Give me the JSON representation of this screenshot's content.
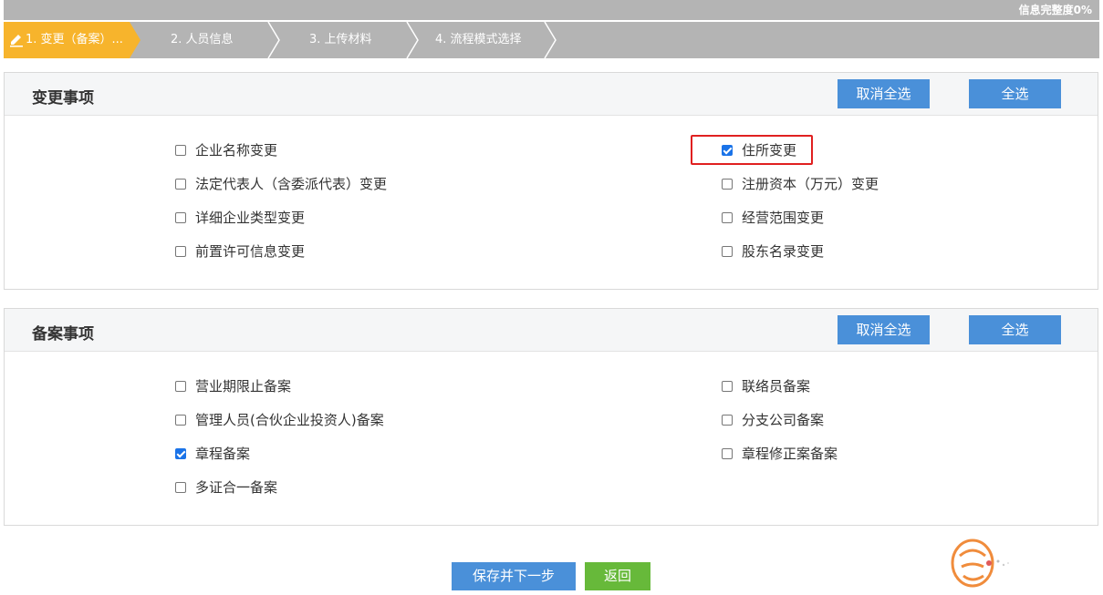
{
  "completion": {
    "text": "信息完整度0%"
  },
  "steps": [
    {
      "label": "1. 变更（备案）...",
      "active": true
    },
    {
      "label": "2. 人员信息",
      "active": false
    },
    {
      "label": "3. 上传材料",
      "active": false
    },
    {
      "label": "4. 流程模式选择",
      "active": false
    }
  ],
  "change_section": {
    "title": "变更事项",
    "cancel_all": "取消全选",
    "select_all": "全选",
    "left_options": [
      {
        "label": "企业名称变更",
        "checked": false
      },
      {
        "label": "法定代表人（含委派代表）变更",
        "checked": false
      },
      {
        "label": "详细企业类型变更",
        "checked": false
      },
      {
        "label": "前置许可信息变更",
        "checked": false
      }
    ],
    "right_options": [
      {
        "label": "住所变更",
        "checked": true
      },
      {
        "label": "注册资本（万元）变更",
        "checked": false
      },
      {
        "label": "经营范围变更",
        "checked": false
      },
      {
        "label": "股东名录变更",
        "checked": false
      }
    ]
  },
  "filing_section": {
    "title": "备案事项",
    "cancel_all": "取消全选",
    "select_all": "全选",
    "left_options": [
      {
        "label": "营业期限止备案",
        "checked": false
      },
      {
        "label": "管理人员(合伙企业投资人)备案",
        "checked": false
      },
      {
        "label": "章程备案",
        "checked": true
      },
      {
        "label": "多证合一备案",
        "checked": false
      }
    ],
    "right_options": [
      {
        "label": "联络员备案",
        "checked": false
      },
      {
        "label": "分支公司备案",
        "checked": false
      },
      {
        "label": "章程修正案备案",
        "checked": false
      }
    ]
  },
  "footer": {
    "save_next": "保存并下一步",
    "back": "返回"
  },
  "colors": {
    "step_active": "#f7b42c",
    "step_bar": "#b4b4b4",
    "primary": "#4a90d9",
    "success": "#67b93a",
    "highlight": "#e02020"
  },
  "icons": {
    "edit": "edit-icon",
    "logo": "logo-icon"
  }
}
